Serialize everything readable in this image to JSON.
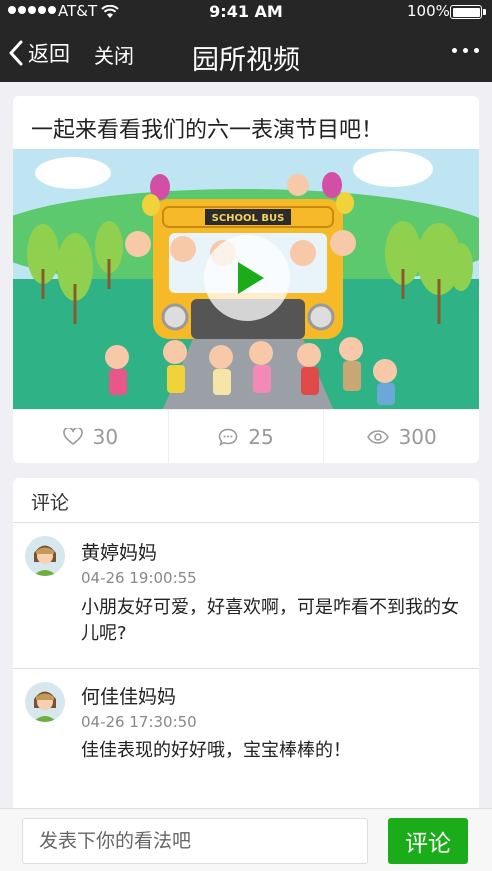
{
  "status_bar": {
    "carrier": "AT&T",
    "time": "9:41 AM",
    "battery": "100%"
  },
  "nav": {
    "back_label": "返回",
    "close_label": "关闭",
    "title": "园所视频"
  },
  "video": {
    "title": "一起来看看我们的六一表演节目吧！",
    "bus_sign": "SCHOOL BUS",
    "likes": "30",
    "comments": "25",
    "views": "300"
  },
  "comments_section": {
    "header": "评论",
    "items": [
      {
        "name": "黄婷妈妈",
        "time": "04-26 19:00:55",
        "text": "小朋友好可爱，好喜欢啊，可是咋看不到我的女儿呢?"
      },
      {
        "name": "何佳佳妈妈",
        "time": "04-26 17:30:50",
        "text": "佳佳表现的好好哦，宝宝棒棒的！"
      }
    ]
  },
  "input_bar": {
    "placeholder": "发表下你的看法吧",
    "send_label": "评论"
  },
  "colors": {
    "nav_bg": "#262626",
    "accent": "#1aad19",
    "page_bg": "#efeff4"
  }
}
